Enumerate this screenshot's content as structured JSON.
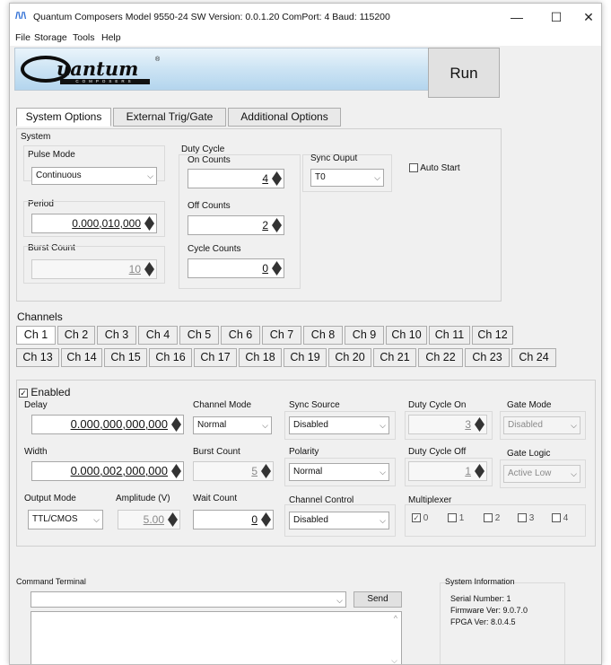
{
  "window": {
    "title": "Quantum Composers Model 9550-24  SW Version: 0.0.1.20 ComPort: 4 Baud: 115200",
    "controls": {
      "minimize": "—",
      "maximize": "☐",
      "close": "✕"
    }
  },
  "menu": [
    "File",
    "Storage",
    "Tools",
    "Help"
  ],
  "logo": {
    "text": "uantum",
    "sub": "COMPOSERS",
    "reg": "®"
  },
  "run_button": "Run",
  "tabs": [
    "System Options",
    "External Trig/Gate",
    "Additional Options"
  ],
  "system": {
    "group_label": "System",
    "pulse_mode": {
      "label": "Pulse Mode",
      "value": "Continuous"
    },
    "period": {
      "label": "Period",
      "value": "0.000,010,000"
    },
    "burst_count": {
      "label": "Burst Count",
      "value": "10"
    },
    "duty_cycle": {
      "label": "Duty Cycle",
      "on_counts": {
        "label": "On Counts",
        "value": "4"
      },
      "off_counts": {
        "label": "Off Counts",
        "value": "2"
      },
      "cycle_counts": {
        "label": "Cycle Counts",
        "value": "0"
      }
    },
    "sync_output": {
      "label": "Sync Ouput",
      "value": "T0"
    },
    "auto_start": {
      "label": "Auto Start",
      "checked": false
    }
  },
  "channels": {
    "label": "Channels",
    "tabs_row1": [
      "Ch 1",
      "Ch 2",
      "Ch 3",
      "Ch 4",
      "Ch 5",
      "Ch 6",
      "Ch 7",
      "Ch 8",
      "Ch 9",
      "Ch 10",
      "Ch 11",
      "Ch 12"
    ],
    "tabs_row2": [
      "Ch 13",
      "Ch 14",
      "Ch 15",
      "Ch 16",
      "Ch 17",
      "Ch 18",
      "Ch 19",
      "Ch 20",
      "Ch 21",
      "Ch 22",
      "Ch 23",
      "Ch 24"
    ],
    "active": "Ch 1"
  },
  "channel": {
    "enabled": {
      "label": "Enabled",
      "checked": true
    },
    "delay": {
      "label": "Delay",
      "value": "0.000,000,000,000"
    },
    "width": {
      "label": "Width",
      "value": "0.000,002,000,000"
    },
    "channel_mode": {
      "label": "Channel Mode",
      "value": "Normal"
    },
    "burst_count": {
      "label": "Burst Count",
      "value": "5"
    },
    "wait_count": {
      "label": "Wait Count",
      "value": "0"
    },
    "sync_source": {
      "label": "Sync Source",
      "value": "Disabled"
    },
    "polarity": {
      "label": "Polarity",
      "value": "Normal"
    },
    "channel_control": {
      "label": "Channel Control",
      "value": "Disabled"
    },
    "duty_cycle_on": {
      "label": "Duty Cycle On",
      "value": "3"
    },
    "duty_cycle_off": {
      "label": "Duty Cycle Off",
      "value": "1"
    },
    "gate_mode": {
      "label": "Gate Mode",
      "value": "Disabled"
    },
    "gate_logic": {
      "label": "Gate Logic",
      "value": "Active Low"
    },
    "output_mode": {
      "label": "Output Mode",
      "value": "TTL/CMOS"
    },
    "amplitude": {
      "label": "Amplitude (V)",
      "value": "5.00"
    },
    "multiplexer": {
      "label": "Multiplexer",
      "items": [
        {
          "label": "0",
          "checked": true
        },
        {
          "label": "1",
          "checked": false
        },
        {
          "label": "2",
          "checked": false
        },
        {
          "label": "3",
          "checked": false
        },
        {
          "label": "4",
          "checked": false
        }
      ]
    }
  },
  "command_terminal": {
    "label": "Command Terminal",
    "input_value": "",
    "send_label": "Send"
  },
  "system_information": {
    "label": "System Information",
    "serial": "Serial Number: 1",
    "firmware": "Firmware Ver: 9.0.7.0",
    "fpga": "FPGA Ver: 8.0.4.5"
  }
}
